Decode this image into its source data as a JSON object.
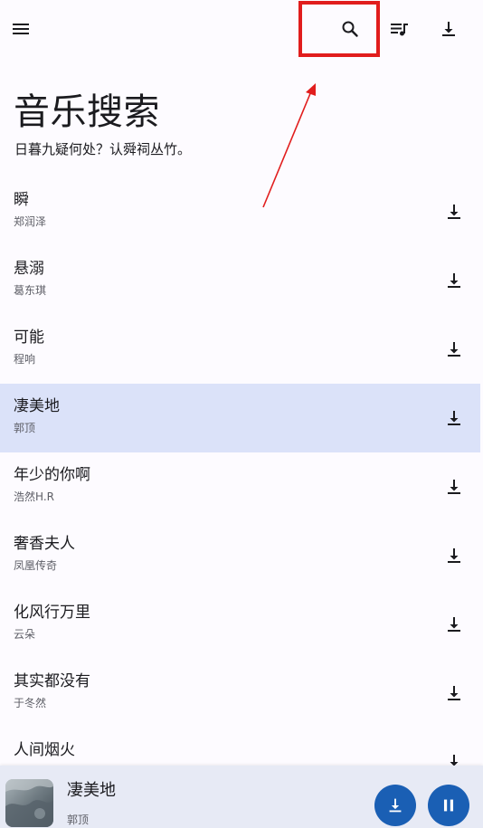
{
  "colors": {
    "background": "#fdfbff",
    "selected_row": "#dbe2f9",
    "player_bar": "#e7eaf5",
    "fab": "#1a5fb4",
    "annotation_red": "#e11d1d"
  },
  "toolbar": {
    "menu_icon": "hamburger-menu-icon",
    "search_icon": "search-icon",
    "queue_icon": "queue-music-icon",
    "download_icon": "download-icon"
  },
  "header": {
    "title": "音乐搜索",
    "subtitle": "日暮九疑何处？认舜祠丛竹。"
  },
  "songs": [
    {
      "title": "瞬",
      "artist": "郑润泽",
      "selected": false
    },
    {
      "title": "悬溺",
      "artist": "葛东琪",
      "selected": false
    },
    {
      "title": "可能",
      "artist": "程响",
      "selected": false
    },
    {
      "title": "凄美地",
      "artist": "郭顶",
      "selected": true
    },
    {
      "title": "年少的你啊",
      "artist": "浩然H.R",
      "selected": false
    },
    {
      "title": "奢香夫人",
      "artist": "凤凰传奇",
      "selected": false
    },
    {
      "title": "化风行万里",
      "artist": "云朵",
      "selected": false
    },
    {
      "title": "其实都没有",
      "artist": "于冬然",
      "selected": false
    },
    {
      "title": "人间烟火",
      "artist": "",
      "selected": false
    }
  ],
  "player": {
    "title": "凄美地",
    "artist": "郭顶",
    "download_icon": "download-icon",
    "pause_icon": "pause-icon"
  }
}
